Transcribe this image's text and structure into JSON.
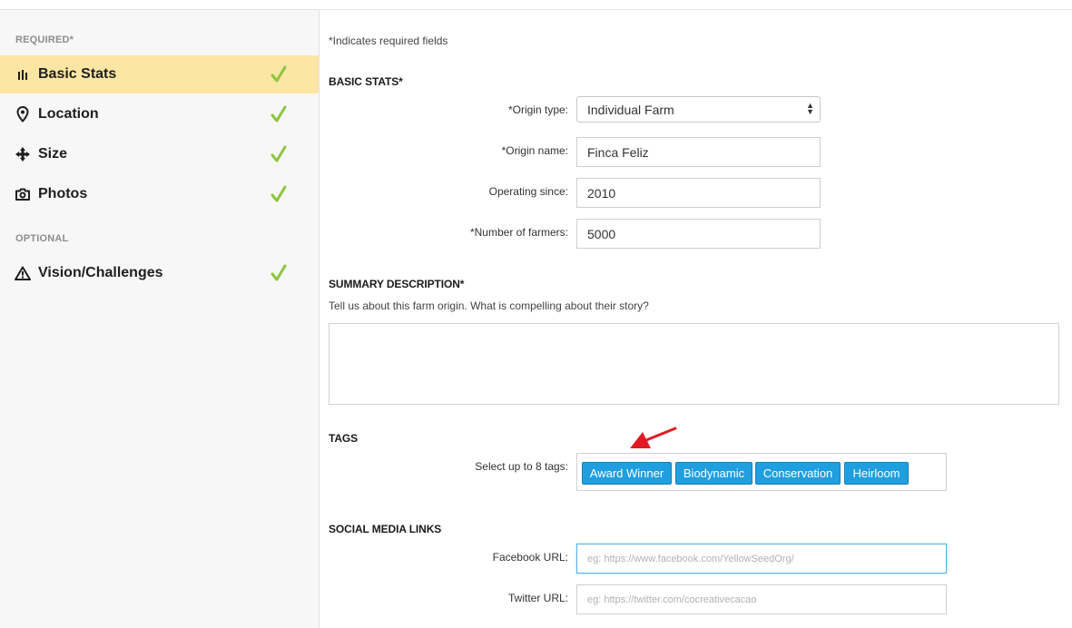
{
  "sidebar": {
    "required_label": "REQUIRED*",
    "optional_label": "OPTIONAL",
    "items": [
      {
        "label": "Basic Stats",
        "icon": "bar-chart-icon",
        "completed": true,
        "active": true
      },
      {
        "label": "Location",
        "icon": "map-pin-icon",
        "completed": true,
        "active": false
      },
      {
        "label": "Size",
        "icon": "expand-arrows-icon",
        "completed": true,
        "active": false
      },
      {
        "label": "Photos",
        "icon": "camera-icon",
        "completed": true,
        "active": false
      },
      {
        "label": "Vision/Challenges",
        "icon": "warning-icon",
        "completed": true,
        "active": false
      }
    ]
  },
  "form": {
    "required_note": "*Indicates required fields",
    "basic_stats": {
      "heading": "BASIC STATS*",
      "origin_type": {
        "label": "*Origin type:",
        "value": "Individual Farm"
      },
      "origin_name": {
        "label": "*Origin name:",
        "value": "Finca Feliz"
      },
      "operating_since": {
        "label": "Operating since:",
        "value": "2010"
      },
      "number_of_farmers": {
        "label": "*Number of farmers:",
        "value": "5000"
      }
    },
    "summary": {
      "heading": "SUMMARY DESCRIPTION*",
      "help": "Tell us about this farm origin. What is compelling about their story?",
      "value": ""
    },
    "tags": {
      "heading": "TAGS",
      "label": "Select up to 8 tags:",
      "selected": [
        "Award Winner",
        "Biodynamic",
        "Conservation",
        "Heirloom"
      ]
    },
    "social": {
      "heading": "SOCIAL MEDIA LINKS",
      "facebook": {
        "label": "Facebook URL:",
        "placeholder": "eg: https://www.facebook.com/YellowSeedOrg/",
        "value": ""
      },
      "twitter": {
        "label": "Twitter URL:",
        "placeholder": "eg: https://twitter.com/cocreativecacao",
        "value": ""
      }
    }
  },
  "colors": {
    "active_nav": "#fde6a4",
    "check": "#8cc63f",
    "tag": "#1f9fe0",
    "annotation_arrow": "#e01b24"
  }
}
